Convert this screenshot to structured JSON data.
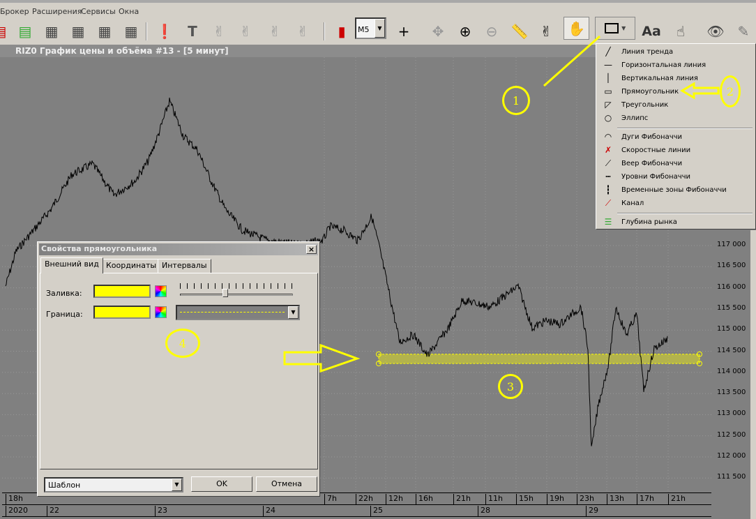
{
  "menu": [
    "Брокер",
    "Расширения",
    "Сервисы",
    "Окна"
  ],
  "toolbar": {
    "interval": "M5",
    "font_button": "Aa"
  },
  "window": {
    "title": "RIZ0 График цены и объёма #13 - [5 минут]"
  },
  "chart_data": {
    "type": "line",
    "price_labels": [
      "117 000",
      "116 500",
      "116 000",
      "115 500",
      "115 000",
      "114 500",
      "114 000",
      "113 500",
      "113 000",
      "112 500",
      "112 000",
      "111 500"
    ],
    "ylim": [
      111300,
      121000
    ],
    "time_row1": [
      "18h",
      "7h",
      "22h",
      "12h",
      "16h",
      "21h",
      "11h",
      "15h",
      "19h",
      "23h",
      "13h",
      "17h",
      "21h"
    ],
    "time_row2": [
      "2020",
      "22",
      "23",
      "24",
      "25",
      "28",
      "29"
    ],
    "bars": [
      1,
      4,
      9,
      14,
      20,
      26,
      32,
      38,
      42,
      45,
      48,
      52,
      56,
      60,
      64,
      69,
      76,
      84,
      92,
      94,
      98,
      102,
      106,
      108,
      111,
      114,
      118,
      122,
      128,
      132,
      140,
      148,
      152,
      156,
      160,
      166,
      168,
      169,
      171,
      174,
      176,
      179,
      182,
      184,
      187,
      191
    ],
    "prices": [
      116040,
      116870,
      117360,
      117860,
      118680,
      118930,
      118190,
      118520,
      119010,
      119670,
      120420,
      119590,
      119260,
      118520,
      117860,
      117360,
      117120,
      117030,
      117120,
      117450,
      117360,
      117120,
      117690,
      117030,
      115880,
      114720,
      114890,
      114390,
      115050,
      115710,
      115550,
      116040,
      115050,
      115220,
      115140,
      115550,
      114560,
      112170,
      113240,
      114230,
      115550,
      114890,
      115380,
      113570,
      114560,
      114810
    ],
    "rectangle": {
      "price_top": 114430,
      "price_bottom": 114210,
      "bar_start": 108,
      "bar_end": 200,
      "fill": "#ffff00"
    }
  },
  "dialog": {
    "title": "Свойства прямоугольника",
    "tabs": [
      "Внешний вид",
      "Координаты",
      "Интервалы"
    ],
    "fill_label": "Заливка:",
    "border_label": "Граница:",
    "fill_color": "#ffff00",
    "border_color": "#ffff00",
    "transparency_level": 0.4,
    "template": "Шаблон",
    "ok": "OK",
    "cancel": "Отмена"
  },
  "popup": {
    "items": [
      "Линия тренда",
      "Горизонтальная линия",
      "Вертикальная линия",
      "Прямоугольник",
      "Треугольник",
      "Эллипс",
      "Дуги Фибоначчи",
      "Скоростные линии",
      "Веер Фибоначчи",
      "Уровни Фибоначчи",
      "Временные зоны Фибоначчи",
      "Канал",
      "Глубина рынка"
    ]
  },
  "annotations": [
    "1",
    "2",
    "3",
    "4"
  ]
}
